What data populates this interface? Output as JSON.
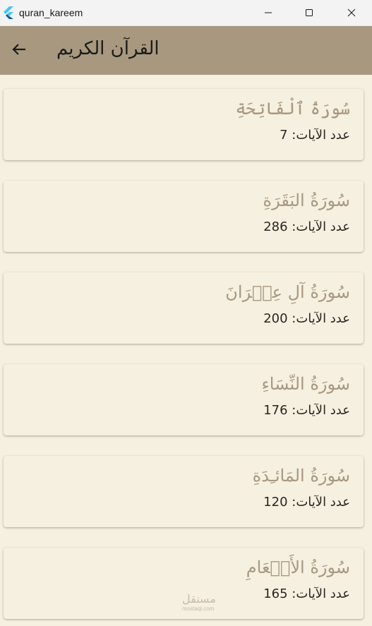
{
  "window": {
    "title": "quran_kareem",
    "icon": "flutter-icon",
    "controls": [
      "minimize-icon",
      "maximize-icon",
      "close-icon"
    ]
  },
  "appbar": {
    "title": "القرآن الكريم",
    "back_icon": "arrow-back-icon"
  },
  "surahs": [
    {
      "name": "سُورَةُ ٱلْفَاتِحَةِ",
      "ayat_label": "عدد الآيات:",
      "ayat_count": "7"
    },
    {
      "name": "سُورَةُ البَقَرَةِ",
      "ayat_label": "عدد الآيات:",
      "ayat_count": "286"
    },
    {
      "name": "سُورَةُ آلِ عِمۡرَانَ",
      "ayat_label": "عدد الآيات:",
      "ayat_count": "200"
    },
    {
      "name": "سُورَةُ النِّسَاءِ",
      "ayat_label": "عدد الآيات:",
      "ayat_count": "176"
    },
    {
      "name": "سُورَةُ المَائـِدَةِ",
      "ayat_label": "عدد الآيات:",
      "ayat_count": "120"
    },
    {
      "name": "سُورَةُ الأَنۡعَامِ",
      "ayat_label": "عدد الآيات:",
      "ayat_count": "165"
    }
  ],
  "watermark": {
    "arabic": "مستقل",
    "latin": "mostaql.com"
  },
  "colors": {
    "appbar": "#a89880",
    "background": "#f5f0e0",
    "surah_name": "#a89880",
    "text": "#2a2620"
  }
}
